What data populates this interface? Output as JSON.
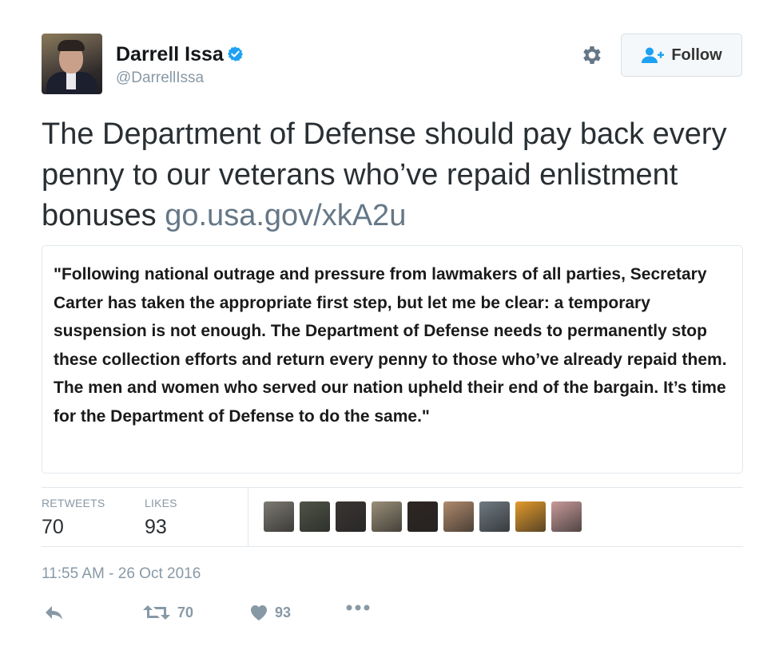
{
  "tweet": {
    "author_name": "Darrell Issa",
    "author_handle": "@DarrellIssa",
    "follow_label": "Follow",
    "text": "The Department of Defense should pay back every penny to our veterans who’ve repaid enlistment bonuses",
    "link_text": "go.usa.gov/xkA2u",
    "quote_image_text": "\"Following national outrage and pressure from lawmakers of all parties, Secretary Carter has taken the appropriate first step, but let me be clear: a temporary suspension is not enough. The Department of Defense needs to permanently stop these collection efforts and return every penny to those who’ve already repaid them. The men and women who served our nation upheld their end of the bargain. It’s time for the Department of Defense to do the same.\"",
    "timestamp": "11:55 AM - 26 Oct 2016"
  },
  "stats": {
    "retweets_label": "RETWEETS",
    "retweets_value": "70",
    "likes_label": "LIKES",
    "likes_value": "93"
  },
  "likers": [
    {
      "color": "#7d7a72"
    },
    {
      "color": "#4f5446"
    },
    {
      "color": "#3a3533"
    },
    {
      "color": "#9a8f78"
    },
    {
      "color": "#2e2622"
    },
    {
      "color": "#b08a6c"
    },
    {
      "color": "#6f7a82"
    },
    {
      "color": "#e39a2c"
    },
    {
      "color": "#c89a9a"
    }
  ],
  "actions": {
    "reply_icon": "reply-icon",
    "retweet_count": "70",
    "like_count": "93",
    "more_icon": "more-icon"
  },
  "colors": {
    "verified_blue": "#1da1f2",
    "follow_icon_blue": "#1da1f2",
    "muted_text": "#8899a6"
  }
}
